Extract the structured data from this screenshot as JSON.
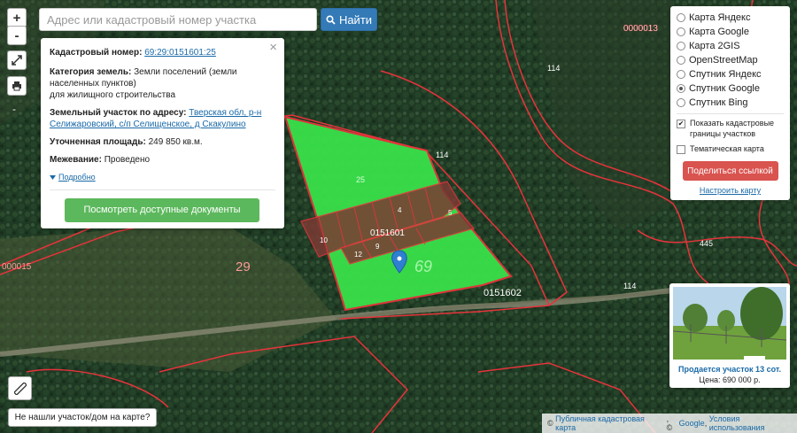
{
  "search": {
    "placeholder": "Адрес или кадастровый номер участка",
    "button_label": "Найти"
  },
  "zoom": {
    "in": "+",
    "out": "-",
    "extra": "-"
  },
  "info": {
    "cad_label": "Кадастровый номер:",
    "cad_value": "69:29:0151601:25",
    "cat_label": "Категория земель:",
    "cat_value_1": "Земли поселений (земли",
    "cat_value_2": "населенных пунктов)",
    "cat_value_3": "для жилищного строительства",
    "addr_label": "Земельный участок по адресу:",
    "addr_value_1": "Тверская обл, р-н",
    "addr_value_2": "Селижаровский, с/п Селищенское, д Скакулино",
    "area_label": "Уточненная площадь:",
    "area_value": "249 850 кв.м.",
    "survey_label": "Межевание:",
    "survey_value": "Проведено",
    "more": "Подробно",
    "docs_button": "Посмотреть доступные документы",
    "close": "×"
  },
  "layers": {
    "options": [
      "Карта Яндекс",
      "Карта Google",
      "Карта 2GIS",
      "OpenStreetMap",
      "Спутник Яндекс",
      "Спутник Google",
      "Спутник Bing"
    ],
    "selected": "Спутник Google",
    "show_boundaries": "Показать кадастровые границы участков",
    "show_boundaries_checked": true,
    "thematic": "Тематическая карта",
    "thematic_checked": false,
    "share": "Поделиться ссылкой",
    "setup": "Настроить карту"
  },
  "ad": {
    "title": "Продается участок 13 сот.",
    "price": "Цена: 690 000 р."
  },
  "not_found": "Не нашли участок/дом на карте?",
  "attribution": {
    "prefix": "©",
    "link1": "Публичная кадастровая карта",
    "sep": ", ©",
    "link2": "Google",
    "link3": "Условия использования"
  },
  "map_labels": {
    "q1": "0000013",
    "q2": "114",
    "q3": "114",
    "q4": "445",
    "q5": "114",
    "q6": "000015",
    "q7": "29",
    "q8": "0151602",
    "q9": "0151601",
    "q10": "25",
    "q11": "69",
    "q12": "4",
    "q13": "5",
    "q14": "10",
    "q15": "12",
    "q16": "9"
  },
  "colors": {
    "parcel_fill": "#39e04a",
    "boundary": "#e8333b",
    "accent": "#337ab7",
    "share": "#d9534f",
    "docs": "#5cb85c",
    "marker": "#2f80d1"
  }
}
